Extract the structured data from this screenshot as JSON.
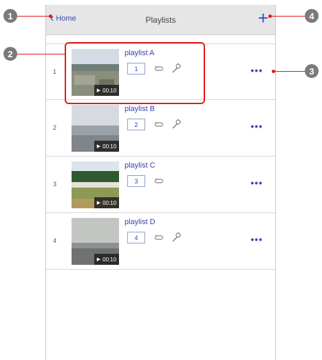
{
  "navbar": {
    "back_label": "Home",
    "title": "Playlists",
    "add_symbol": "+"
  },
  "playlists": [
    {
      "index": "1",
      "name": "playlist A",
      "number": "1",
      "duration": "00:10",
      "has_effect": true
    },
    {
      "index": "2",
      "name": "playlist B",
      "number": "2",
      "duration": "00:10",
      "has_effect": true
    },
    {
      "index": "3",
      "name": "playlist C",
      "number": "3",
      "duration": "00:10",
      "has_effect": false
    },
    {
      "index": "4",
      "name": "playlist D",
      "number": "4",
      "duration": "00:10",
      "has_effect": true
    }
  ],
  "callouts": [
    "1",
    "2",
    "3",
    "4"
  ],
  "colors": {
    "accent": "#3b4bb8",
    "callout": "#e01a1a",
    "navbar_bg": "#e6e6e6"
  }
}
